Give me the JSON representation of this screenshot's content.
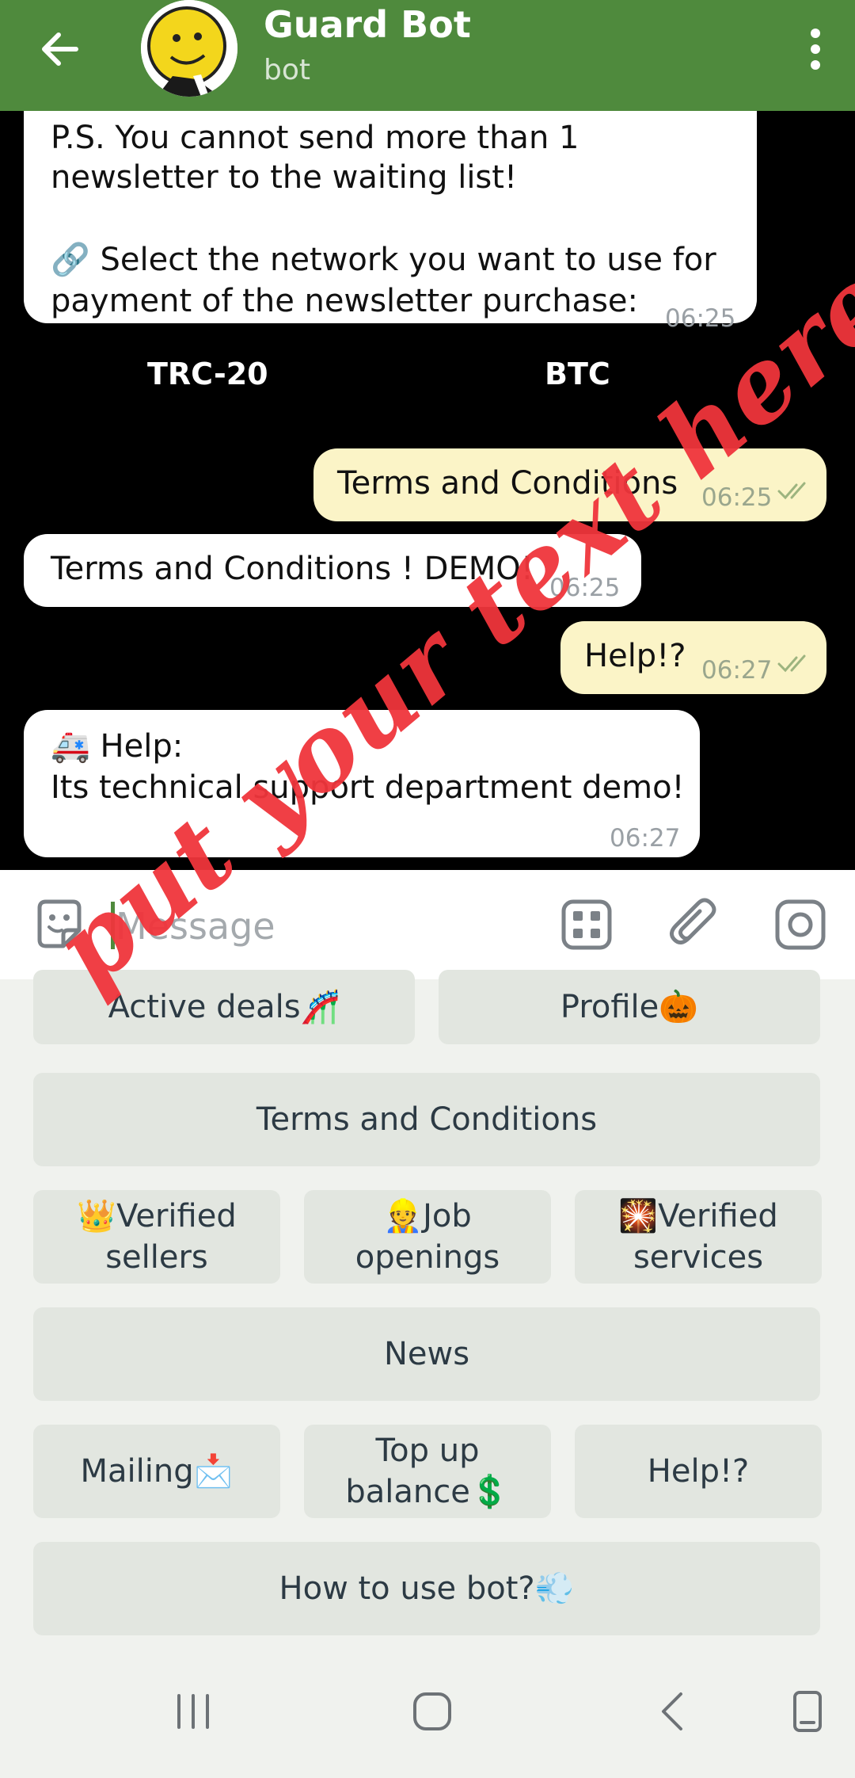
{
  "header": {
    "title": "Guard Bot",
    "subtitle": "bot"
  },
  "messages": [
    {
      "id": "m1",
      "dir": "in",
      "text_1": "P.S. You cannot send more than 1",
      "text_2": "newsletter to the waiting list!",
      "text_3": "🔗 Select the network you want to use for",
      "text_4": "payment of the newsletter purchase:",
      "time": "06:25"
    },
    {
      "id": "m2",
      "dir": "out",
      "text": "Terms and Conditions",
      "time": "06:25"
    },
    {
      "id": "m3",
      "dir": "in",
      "text": "Terms and Conditions ! DEMO!",
      "time": "06:25"
    },
    {
      "id": "m4",
      "dir": "out",
      "text": "Help!?",
      "time": "06:27"
    },
    {
      "id": "m5",
      "dir": "in",
      "text_1": "🚑 Help:",
      "text_2": "Its technical support department demo!",
      "time": "06:27"
    }
  ],
  "inline_keyboard": {
    "buttons": [
      "TRC-20",
      "BTC"
    ]
  },
  "input": {
    "placeholder": "Message"
  },
  "reply_keyboard": {
    "row1": [
      "Active deals🎢",
      "Profile🎃"
    ],
    "row2": [
      "Terms and Conditions"
    ],
    "row3": [
      "👑Verified sellers",
      "👷Job openings",
      "🎇Verified services"
    ],
    "row4": [
      "News"
    ],
    "row5": [
      "Mailing📩",
      "Top up balance💲",
      "Help!?"
    ],
    "row6": [
      "How to use bot?💨"
    ]
  },
  "watermark": "put your text here",
  "colors": {
    "header": "#4f8a3d",
    "bubble_out": "#fbf4c7",
    "bubble_in": "#ffffff",
    "watermark": "#f0353c"
  },
  "icons": [
    "back-arrow-icon",
    "more-vert-icon",
    "sticker-icon",
    "bot-commands-icon",
    "attach-icon",
    "camera-icon",
    "recents-icon",
    "home-icon",
    "nav-back-icon",
    "rotate-icon",
    "double-check-icon"
  ]
}
